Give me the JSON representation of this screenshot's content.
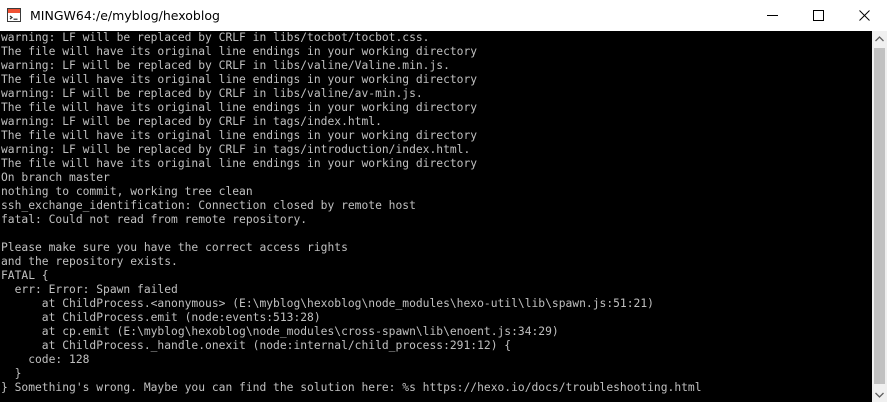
{
  "window": {
    "title": "MINGW64:/e/myblog/hexoblog",
    "icon": "git-bash-icon",
    "controls": [
      "minimize-icon",
      "maximize-icon",
      "close-icon"
    ]
  },
  "terminal": {
    "foreground": "#c0c0c0",
    "background": "#000000",
    "lines": [
      "warning: LF will be replaced by CRLF in libs/tocbot/tocbot.css.",
      "The file will have its original line endings in your working directory",
      "warning: LF will be replaced by CRLF in libs/valine/Valine.min.js.",
      "The file will have its original line endings in your working directory",
      "warning: LF will be replaced by CRLF in libs/valine/av-min.js.",
      "The file will have its original line endings in your working directory",
      "warning: LF will be replaced by CRLF in tags/index.html.",
      "The file will have its original line endings in your working directory",
      "warning: LF will be replaced by CRLF in tags/introduction/index.html.",
      "The file will have its original line endings in your working directory",
      "On branch master",
      "nothing to commit, working tree clean",
      "ssh_exchange_identification: Connection closed by remote host",
      "fatal: Could not read from remote repository.",
      "",
      "Please make sure you have the correct access rights",
      "and the repository exists.",
      "FATAL {",
      "  err: Error: Spawn failed",
      "      at ChildProcess.<anonymous> (E:\\myblog\\hexoblog\\node_modules\\hexo-util\\lib\\spawn.js:51:21)",
      "      at ChildProcess.emit (node:events:513:28)",
      "      at cp.emit (E:\\myblog\\hexoblog\\node_modules\\cross-spawn\\lib\\enoent.js:34:29)",
      "      at ChildProcess._handle.onexit (node:internal/child_process:291:12) {",
      "    code: 128",
      "  }",
      "} Something's wrong. Maybe you can find the solution here: %s https://hexo.io/docs/troubleshooting.html"
    ]
  }
}
